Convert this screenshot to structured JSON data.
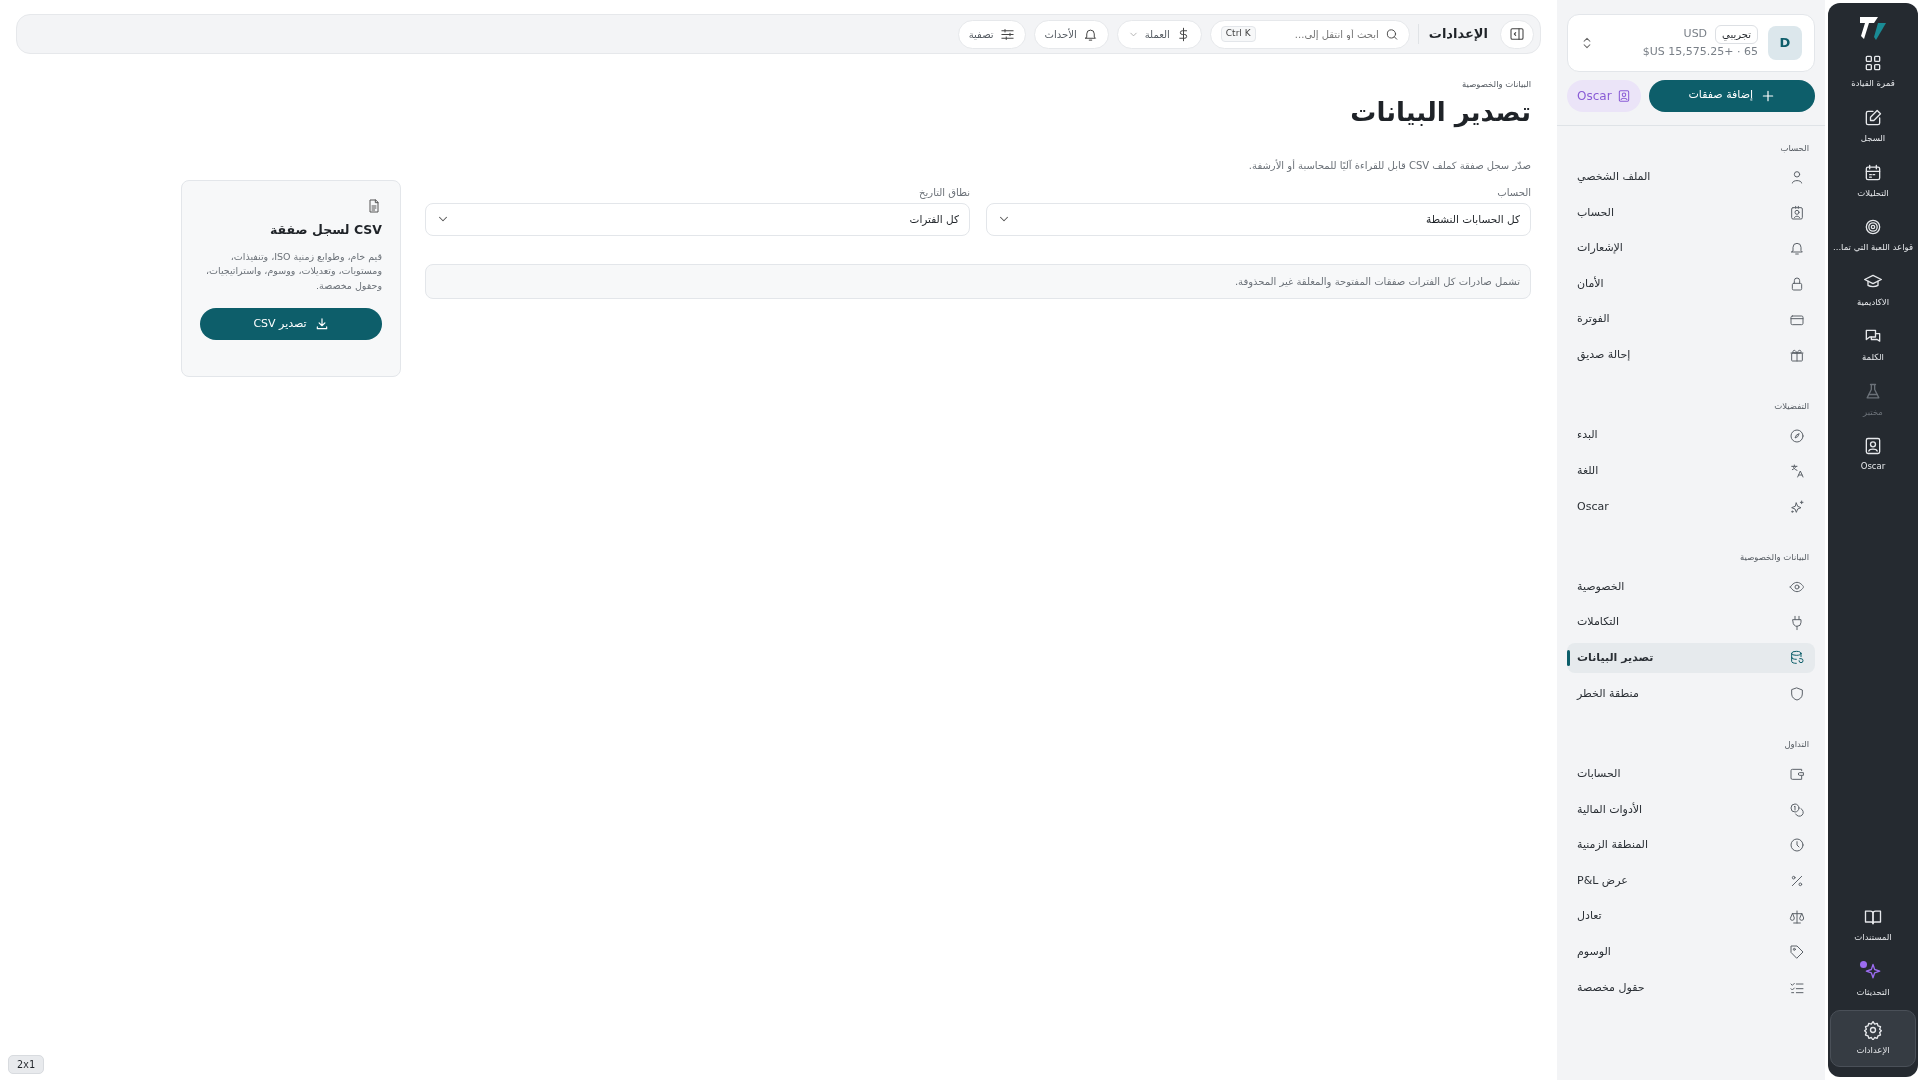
{
  "rail": {
    "items": [
      {
        "label": "قمرة القيادة",
        "disabled": false,
        "selected": false
      },
      {
        "label": "السجل",
        "disabled": false,
        "selected": false
      },
      {
        "label": "التحليلات",
        "disabled": false,
        "selected": false
      },
      {
        "label": "قواعد اللعبة التي تما...",
        "disabled": false,
        "selected": false
      },
      {
        "label": "الاكاديمية",
        "disabled": false,
        "selected": false
      },
      {
        "label": "الكلمة",
        "disabled": false,
        "selected": false
      },
      {
        "label": "مختبر",
        "disabled": true,
        "selected": false
      },
      {
        "label": "Oscar",
        "disabled": false,
        "selected": false
      }
    ],
    "bottom_items": [
      {
        "label": "المستندات",
        "selected": false
      },
      {
        "label": "التحديثات",
        "selected": false
      },
      {
        "label": "الإعدادات",
        "selected": true
      }
    ]
  },
  "account_card": {
    "avatar": "D",
    "badge": "تجريبي",
    "currency": "USD",
    "balance": "$US 15,575.25+ · 65"
  },
  "add_trades_button": "إضافة صفقات",
  "oscar_button": "Oscar",
  "sidebar": {
    "sections": [
      {
        "title": "الحساب",
        "items": [
          {
            "label": "الملف الشخصي",
            "selected": false
          },
          {
            "label": "الحساب",
            "selected": false
          },
          {
            "label": "الإشعارات",
            "selected": false
          },
          {
            "label": "الأمان",
            "selected": false
          },
          {
            "label": "الفوترة",
            "selected": false
          },
          {
            "label": "إحالة صديق",
            "selected": false
          }
        ]
      },
      {
        "title": "التفضيلات",
        "items": [
          {
            "label": "البدء",
            "selected": false
          },
          {
            "label": "اللغة",
            "selected": false
          },
          {
            "label": "Oscar",
            "selected": false
          }
        ]
      },
      {
        "title": "البيانات والخصوصية",
        "items": [
          {
            "label": "الخصوصية",
            "selected": false
          },
          {
            "label": "التكاملات",
            "selected": false
          },
          {
            "label": "تصدير البيانات",
            "selected": true
          },
          {
            "label": "منطقة الخطر",
            "selected": false
          }
        ]
      },
      {
        "title": "التداول",
        "items": [
          {
            "label": "الحسابات",
            "selected": false
          },
          {
            "label": "الأدوات المالية",
            "selected": false
          },
          {
            "label": "المنطقة الزمنية",
            "selected": false
          },
          {
            "label": "عرض P&L",
            "selected": false
          },
          {
            "label": "تعادل",
            "selected": false
          },
          {
            "label": "الوسوم",
            "selected": false
          },
          {
            "label": "حقول مخصصة",
            "selected": false
          }
        ]
      }
    ]
  },
  "topbar": {
    "title": "الإعدادات",
    "search": {
      "placeholder": "ابحث أو انتقل إلى...",
      "shortcut": "Ctrl K"
    },
    "currency": "العملة",
    "events": "الأحداث",
    "filter": "تصفية"
  },
  "page": {
    "breadcrumb": "البيانات والخصوصية",
    "title": "تصدير البيانات",
    "description": "صدّر سجل صفقة كملف CSV قابل للقراءة آليًا للمحاسبة أو الأرشفة.",
    "fields": [
      {
        "label": "الحساب",
        "value": "كل الحسابات النشطة"
      },
      {
        "label": "نطاق التاريخ",
        "value": "كل الفترات"
      }
    ],
    "note": "تشمل صادرات كل الفترات صفقات المفتوحة والمغلقة غير المحذوفة.",
    "export_card": {
      "title": "CSV لسجل صفقة",
      "description": "قيم خام، وطوابع زمنية ISO، وتنفيذات، ومستويات، وتعديلات، ووسوم، واستراتيجيات، وحقول مخصصة.",
      "button": "تصدير CSV"
    }
  },
  "zoom_badge": "2x1"
}
